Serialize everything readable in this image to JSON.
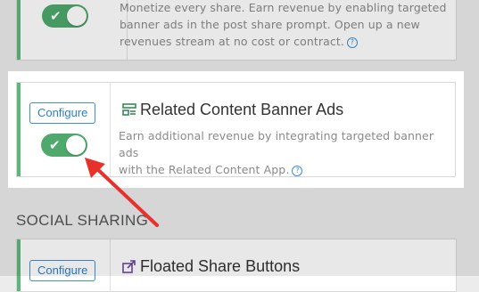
{
  "cards": [
    {
      "description_lines": [
        "Monetize every share. Earn revenue by enabling targeted",
        "banner ads in the post share prompt. Open up a new",
        "revenues stream at no cost or contract."
      ],
      "toggle_on": true
    },
    {
      "configure_label": "Configure",
      "title": "Related Content Banner Ads",
      "title_icon": "banner-ads-icon",
      "description_lines": [
        "Earn additional revenue by integrating targeted banner ads",
        "with the Related Content App."
      ],
      "toggle_on": true
    },
    {
      "configure_label": "Configure",
      "title": "Floated Share Buttons",
      "title_icon": "share-icon"
    }
  ],
  "section": {
    "title": "SOCIAL SHARING"
  },
  "help_icon_glyph": "?",
  "toggle_check_glyph": "✔",
  "colors": {
    "accent_green": "#5cb87a",
    "toggle_green": "#4fa96c",
    "link_blue": "#2f80c7",
    "arrow_red": "#e8312a"
  }
}
